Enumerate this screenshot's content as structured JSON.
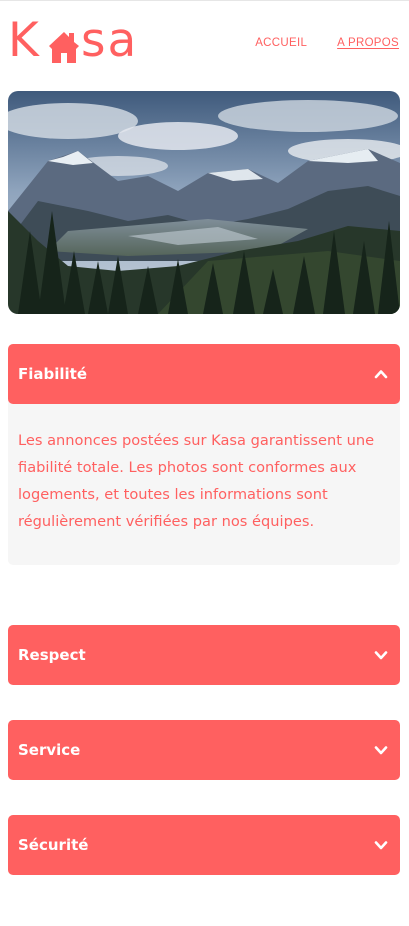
{
  "header": {
    "logo": {
      "left": "K",
      "right": "sa",
      "icon": "house-icon"
    },
    "nav": [
      {
        "label": "ACCUEIL",
        "active": false
      },
      {
        "label": "A PROPOS",
        "active": true
      }
    ]
  },
  "banner": {
    "image": "mountain-landscape"
  },
  "collapses": [
    {
      "title": "Fiabilité",
      "open": true,
      "icon": "chevron-up-icon",
      "text": "Les annonces postées sur Kasa garantissent une fiabilité totale. Les photos sont conformes aux logements, et toutes les informations sont régulièrement vérifiées par nos équipes."
    },
    {
      "title": "Respect",
      "open": false,
      "icon": "chevron-down-icon"
    },
    {
      "title": "Service",
      "open": false,
      "icon": "chevron-down-icon"
    },
    {
      "title": "Sécurité",
      "open": false,
      "icon": "chevron-down-icon"
    }
  ],
  "colors": {
    "primary": "#FF6060",
    "panel": "#F6F6F6",
    "text_on_primary": "#FFFFFF"
  }
}
